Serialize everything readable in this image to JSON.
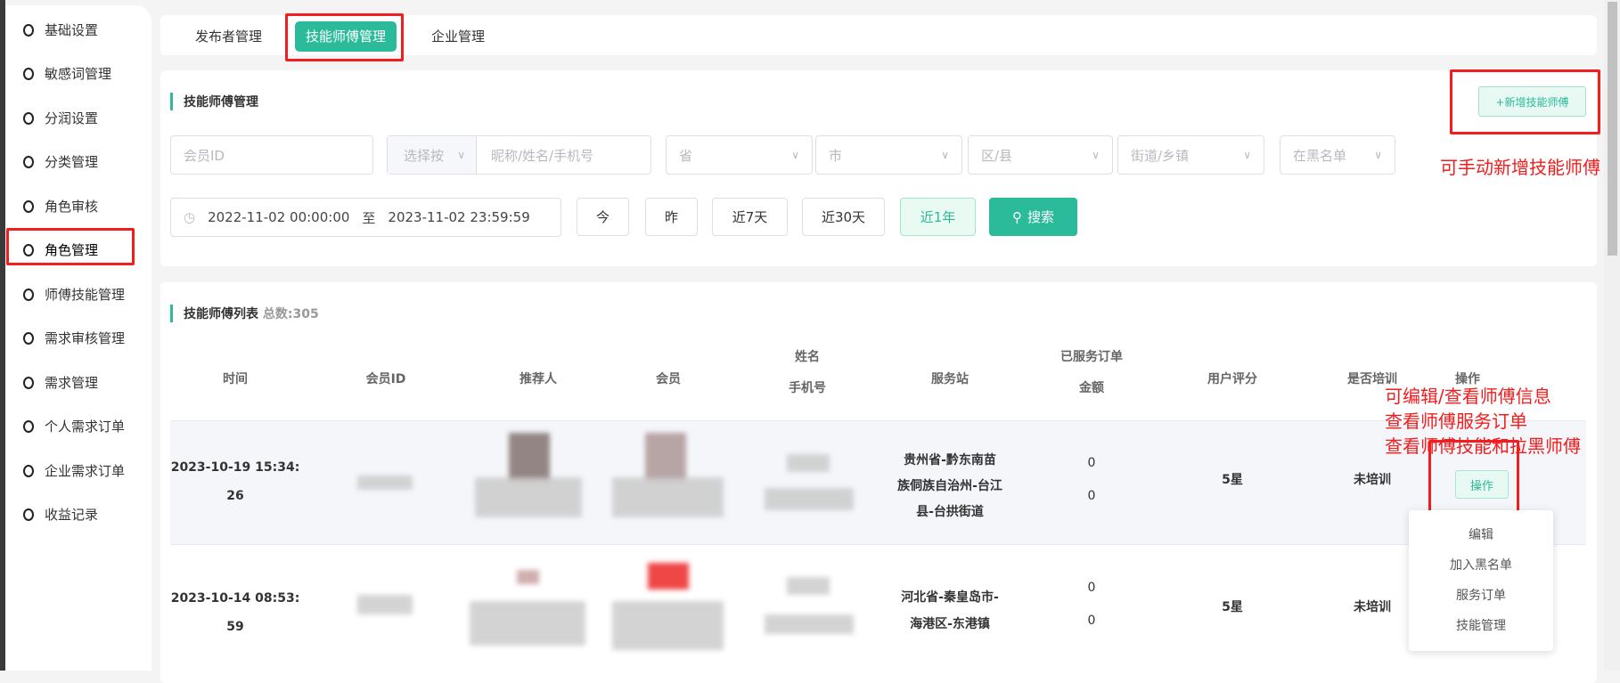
{
  "sidebar": {
    "items": [
      "基础设置",
      "敏感词管理",
      "分润设置",
      "分类管理",
      "角色审核",
      "角色管理",
      "师傅技能管理",
      "需求审核管理",
      "需求管理",
      "个人需求订单",
      "企业需求订单",
      "收益记录"
    ],
    "active": "角色管理"
  },
  "tabs": [
    "发布者管理",
    "技能师傅管理",
    "企业管理"
  ],
  "filter": {
    "title": "技能师傅管理",
    "add_button": "+新增技能师傅",
    "member_id_placeholder": "会员ID",
    "select_by": "选择按",
    "keyword_placeholder": "昵称/姓名/手机号",
    "province": "省",
    "city": "市",
    "district": "区/县",
    "street": "街道/乡镇",
    "blacklist": "在黑名单",
    "date_start": "2022-11-02 00:00:00",
    "date_sep": "至",
    "date_end": "2023-11-02 23:59:59",
    "quick": [
      "今",
      "昨",
      "近7天",
      "近30天",
      "近1年"
    ],
    "search": "搜索"
  },
  "list": {
    "title": "技能师傅列表",
    "total_label": "总数:",
    "total": "305",
    "headers": {
      "time": "时间",
      "member_id": "会员ID",
      "referrer": "推荐人",
      "member": "会员",
      "name": "姓名",
      "phone": "手机号",
      "station": "服务站",
      "orders": "已服务订单",
      "amount": "金额",
      "rating": "用户评分",
      "trained": "是否培训",
      "action": "操作"
    },
    "rows": [
      {
        "time1": "2023-10-19 15:34:",
        "time2": "26",
        "station": [
          "贵州省-黔东南苗",
          "族侗族自治州-台江",
          "县-台拱街道"
        ],
        "orders": "0",
        "amount": "0",
        "rating": "5星",
        "trained": "未培训",
        "action": "操作"
      },
      {
        "time1": "2023-10-14 08:53:",
        "time2": "59",
        "station": [
          "河北省-秦皇岛市-",
          "海港区-东港镇"
        ],
        "orders": "0",
        "amount": "0",
        "rating": "5星",
        "trained": "未培训"
      }
    ],
    "menu": [
      "编辑",
      "加入黑名单",
      "服务订单",
      "技能管理"
    ]
  },
  "annotations": {
    "add": "可手动新增技能师傅",
    "ops": [
      "可编辑/查看师傅信息",
      "查看师傅服务订单",
      "查看师傅技能和拉黑师傅"
    ]
  }
}
